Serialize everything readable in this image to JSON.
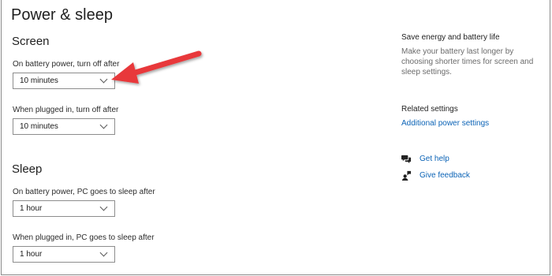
{
  "page": {
    "title": "Power & sleep"
  },
  "screen": {
    "heading": "Screen",
    "battery": {
      "label": "On battery power, turn off after",
      "value": "10 minutes"
    },
    "plugged": {
      "label": "When plugged in, turn off after",
      "value": "10 minutes"
    }
  },
  "sleep": {
    "heading": "Sleep",
    "battery": {
      "label": "On battery power, PC goes to sleep after",
      "value": "1 hour"
    },
    "plugged": {
      "label": "When plugged in, PC goes to sleep after",
      "value": "1 hour"
    }
  },
  "sidebar": {
    "energy_heading": "Save energy and battery life",
    "energy_text": "Make your battery last longer by choosing shorter times for screen and sleep settings.",
    "related_heading": "Related settings",
    "additional_power_link": "Additional power settings",
    "get_help": "Get help",
    "give_feedback": "Give feedback"
  },
  "colors": {
    "annotation_arrow": "#e8383a",
    "link": "#0b63b6"
  },
  "icons": {
    "help": "chat-bubbles-icon",
    "feedback": "person-feedback-icon",
    "chevron": "chevron-down-icon"
  }
}
